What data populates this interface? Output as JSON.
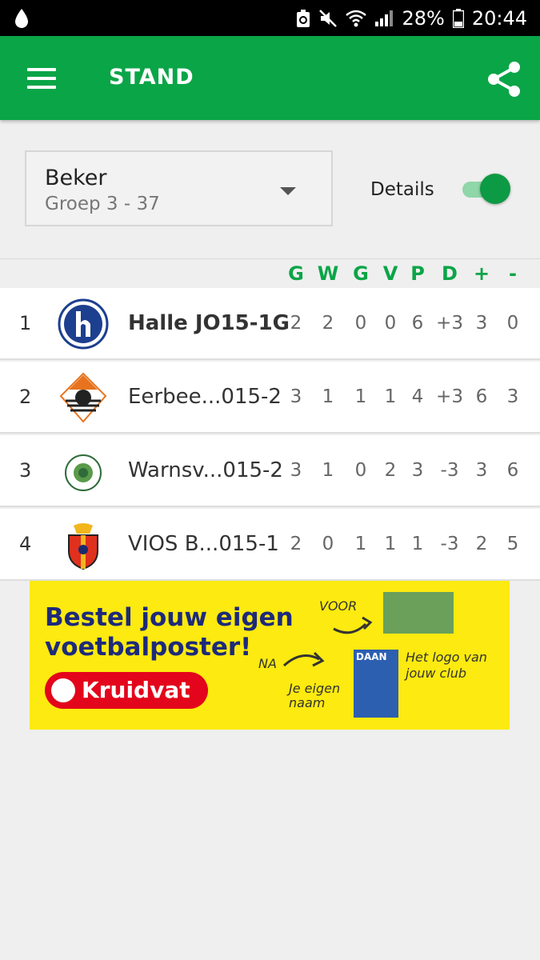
{
  "status_bar": {
    "battery": "28%",
    "time": "20:44"
  },
  "app_bar": {
    "title": "STAND"
  },
  "selector": {
    "competition": "Beker",
    "group": "Groep 3 - 37"
  },
  "details_toggle": {
    "label": "Details",
    "on": true
  },
  "table": {
    "columns": [
      "G",
      "W",
      "G",
      "V",
      "P",
      "D",
      "+",
      "-"
    ],
    "rows": [
      {
        "rank": "1",
        "team": "Halle JO15-1G",
        "own_team": true,
        "stats": [
          "2",
          "2",
          "0",
          "0",
          "6",
          "+3",
          "3",
          "0"
        ]
      },
      {
        "rank": "2",
        "team": "Eerbee...015-2",
        "own_team": false,
        "stats": [
          "3",
          "1",
          "1",
          "1",
          "4",
          "+3",
          "6",
          "3"
        ]
      },
      {
        "rank": "3",
        "team": "Warnsv...015-2",
        "own_team": false,
        "stats": [
          "3",
          "1",
          "0",
          "2",
          "3",
          "-3",
          "3",
          "6"
        ]
      },
      {
        "rank": "4",
        "team": "VIOS B...015-1",
        "own_team": false,
        "stats": [
          "2",
          "0",
          "1",
          "1",
          "1",
          "-3",
          "2",
          "5"
        ]
      }
    ]
  },
  "ad": {
    "headline_line1": "Bestel jouw eigen",
    "headline_line2": "voetbalposter!",
    "brand": "Kruidvat",
    "voor": "VOOR",
    "na": "NA",
    "eigen_naam": "Je eigen naam",
    "logo_club": "Het logo van jouw club",
    "poster_name": "DAAN"
  },
  "colors": {
    "accent": "#0aa547",
    "ad_background": "#fcea10",
    "ad_brand": "#e3051b"
  }
}
